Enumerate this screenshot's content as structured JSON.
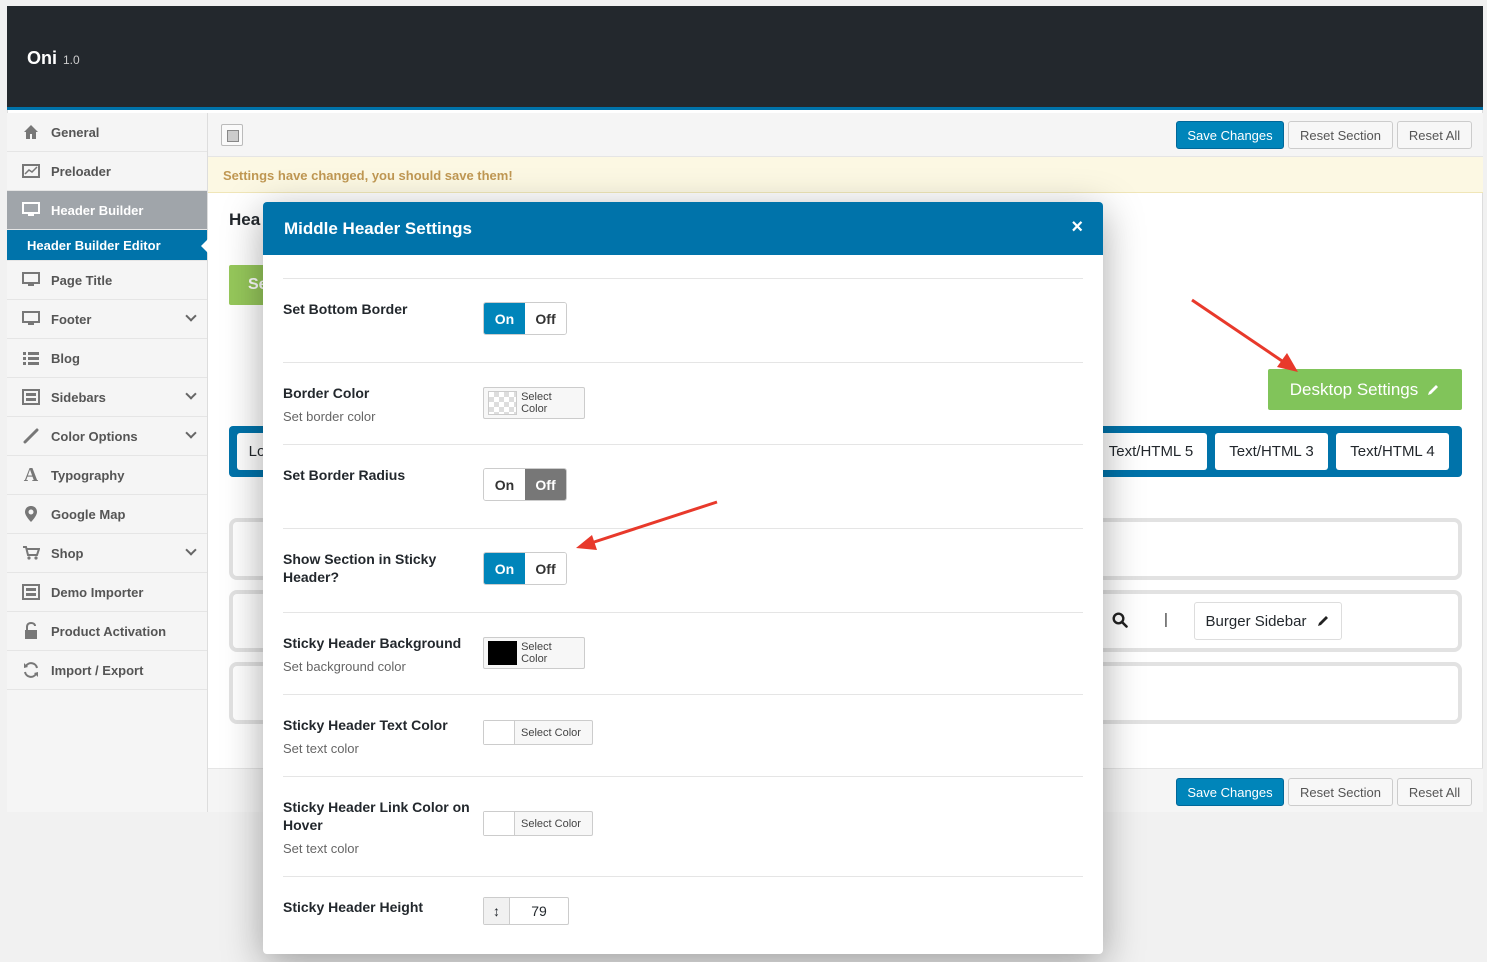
{
  "app": {
    "name": "Oni",
    "version": "1.0"
  },
  "sidebar": {
    "items": [
      {
        "label": "General",
        "icon": "home-icon"
      },
      {
        "label": "Preloader",
        "icon": "chart-icon"
      },
      {
        "label": "Header Builder",
        "icon": "monitor-icon"
      },
      {
        "label": "Header Builder Editor"
      },
      {
        "label": "Page Title",
        "icon": "monitor-icon"
      },
      {
        "label": "Footer",
        "icon": "monitor-icon"
      },
      {
        "label": "Blog",
        "icon": "list-icon"
      },
      {
        "label": "Sidebars",
        "icon": "layout-icon"
      },
      {
        "label": "Color Options",
        "icon": "brush-icon"
      },
      {
        "label": "Typography",
        "icon": "typography-icon"
      },
      {
        "label": "Google Map",
        "icon": "map-pin-icon"
      },
      {
        "label": "Shop",
        "icon": "cart-icon"
      },
      {
        "label": "Demo Importer",
        "icon": "layout-icon"
      },
      {
        "label": "Product Activation",
        "icon": "unlock-icon"
      },
      {
        "label": "Import / Export",
        "icon": "refresh-icon"
      }
    ]
  },
  "toolbar": {
    "save": "Save Changes",
    "reset_section": "Reset Section",
    "reset_all": "Reset All"
  },
  "notice": "Settings have changed, you should save them!",
  "background": {
    "heading": "Hea",
    "green_btn": "Se",
    "desktop_settings": "Desktop Settings",
    "chips": [
      "Lo",
      "Text/HTML 5",
      "Text/HTML 3",
      "Text/HTML 4"
    ],
    "burger": "Burger Sidebar",
    "pipe": "|"
  },
  "modal": {
    "title": "Middle Header Settings",
    "close": "×",
    "fields": {
      "bottom_border": {
        "label": "Set Bottom Border",
        "on": "On",
        "off": "Off"
      },
      "border_color": {
        "label": "Border Color",
        "desc": "Set border color",
        "btn": "Select Color"
      },
      "border_radius": {
        "label": "Set Border Radius",
        "on": "On",
        "off": "Off"
      },
      "sticky_show": {
        "label": "Show Section in Sticky Header?",
        "on": "On",
        "off": "Off"
      },
      "sticky_bg": {
        "label": "Sticky Header Background",
        "desc": "Set background color",
        "btn": "Select Color",
        "color": "#000000"
      },
      "sticky_text": {
        "label": "Sticky Header Text Color",
        "desc": "Set text color",
        "btn": "Select Color"
      },
      "sticky_link": {
        "label": "Sticky Header Link Color on Hover",
        "desc": "Set text color",
        "btn": "Select Color"
      },
      "sticky_height": {
        "label": "Sticky Header Height",
        "value": "79",
        "handle": "↕"
      }
    }
  },
  "colors": {
    "brand_blue": "#0073aa",
    "primary_btn": "#0085ba",
    "green": "#81c45a",
    "arrow": "#e8392b"
  }
}
